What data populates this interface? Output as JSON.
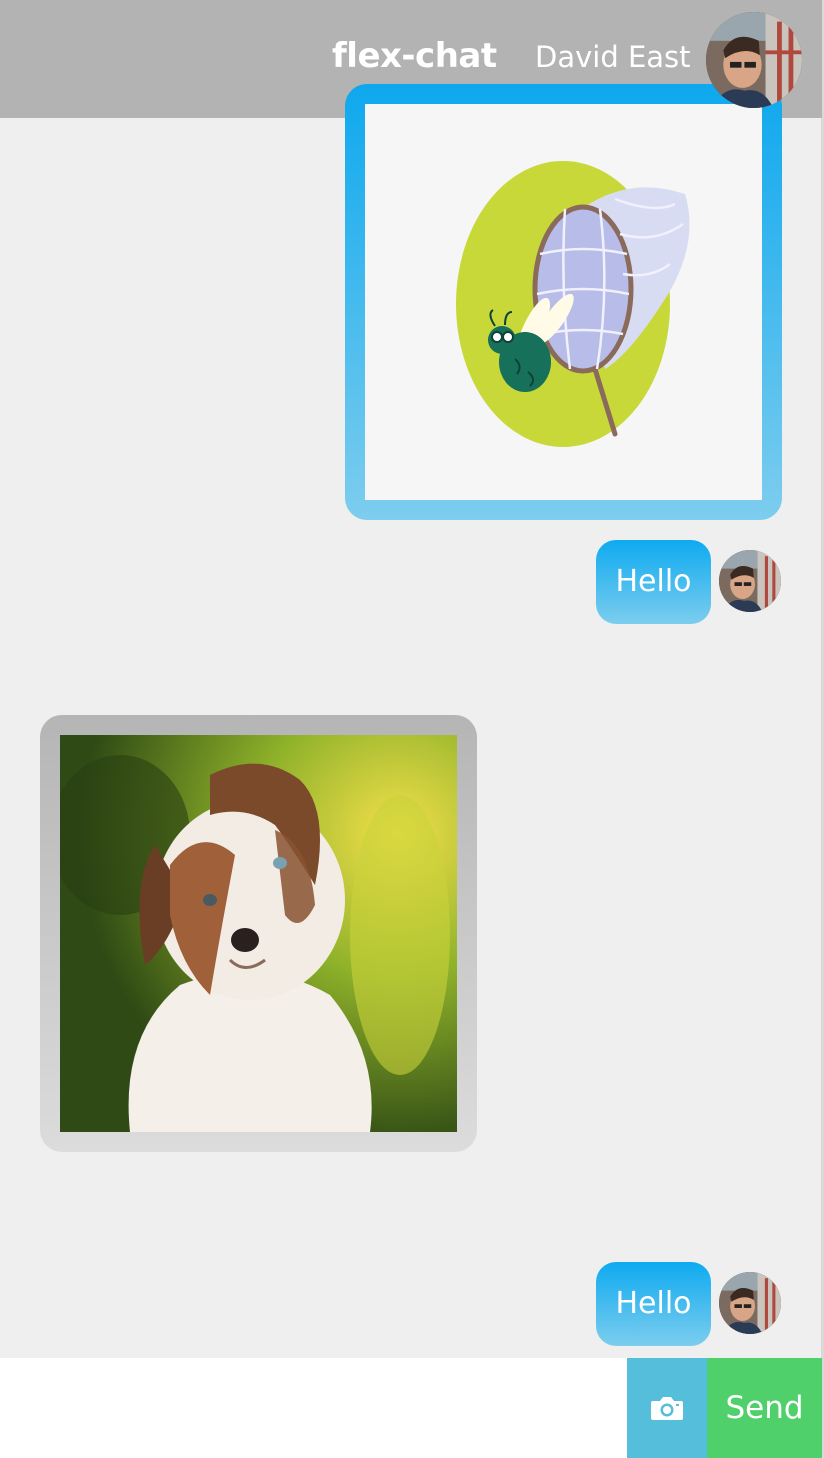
{
  "header": {
    "brand": "flex-chat",
    "user_name": "David East"
  },
  "messages": [
    {
      "type": "image",
      "side": "right",
      "image_subject": "beetle-net-illustration"
    },
    {
      "type": "text",
      "side": "right",
      "text": "Hello"
    },
    {
      "type": "image",
      "side": "left",
      "image_subject": "puppy-photo"
    },
    {
      "type": "text",
      "side": "right",
      "text": "Hello"
    }
  ],
  "composer": {
    "input_value": "",
    "camera_icon": "camera-icon",
    "send_label": "Send"
  },
  "colors": {
    "header_bg": "#b3b3b3",
    "own_bubble_top": "#0eaaf0",
    "own_bubble_bottom": "#7ccdee",
    "other_bubble_top": "#b5b5b5",
    "other_bubble_bottom": "#dcdcdc",
    "camera_bg": "#55bedb",
    "send_bg": "#4fd06a",
    "page_bg": "#efefef"
  }
}
